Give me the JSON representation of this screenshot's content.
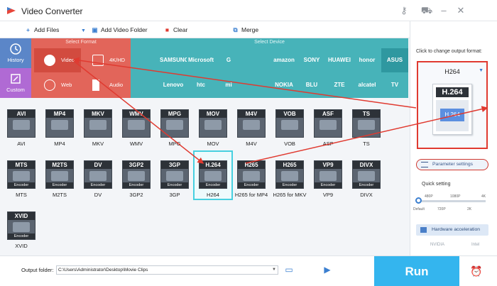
{
  "window": {
    "title": "Video Converter"
  },
  "toolbar": {
    "add_files": "Add Files",
    "add_video_folder": "Add Video Folder",
    "clear": "Clear",
    "merge": "Merge"
  },
  "nav": {
    "history": "History",
    "custom": "Custom"
  },
  "categories": {
    "header": "Select Format",
    "items": [
      {
        "label": "Video",
        "active": true
      },
      {
        "label": "4K/HD",
        "active": false
      },
      {
        "label": "Web",
        "active": false
      },
      {
        "label": "Audio",
        "active": false
      }
    ]
  },
  "devices": {
    "header": "Select Device",
    "brands": [
      "",
      "SAMSUNG",
      "Microsoft",
      "G",
      "",
      "amazon",
      "SONY",
      "HUAWEI",
      "honor",
      "ASUS",
      "",
      "Lenovo",
      "htc",
      "mi",
      "",
      "NOKIA",
      "BLU",
      "ZTE",
      "alcatel",
      "TV"
    ]
  },
  "formats": [
    {
      "tag": "AVI",
      "name": "AVI",
      "encoder": false
    },
    {
      "tag": "MP4",
      "name": "MP4",
      "encoder": false
    },
    {
      "tag": "MKV",
      "name": "MKV",
      "encoder": false
    },
    {
      "tag": "WMV",
      "name": "WMV",
      "encoder": false
    },
    {
      "tag": "MPG",
      "name": "MPG",
      "encoder": false
    },
    {
      "tag": "MOV",
      "name": "MOV",
      "encoder": false
    },
    {
      "tag": "M4V",
      "name": "M4V",
      "encoder": false
    },
    {
      "tag": "VOB",
      "name": "VOB",
      "encoder": false
    },
    {
      "tag": "ASF",
      "name": "ASF",
      "encoder": false
    },
    {
      "tag": "TS",
      "name": "TS",
      "encoder": false
    },
    {
      "tag": "MTS",
      "name": "MTS",
      "encoder": true
    },
    {
      "tag": "M2TS",
      "name": "M2TS",
      "encoder": true
    },
    {
      "tag": "DV",
      "name": "DV",
      "encoder": true
    },
    {
      "tag": "3GP2",
      "name": "3GP2",
      "encoder": true
    },
    {
      "tag": "3GP",
      "name": "3GP",
      "encoder": true
    },
    {
      "tag": "H.264",
      "name": "H264",
      "encoder": true,
      "selected": true
    },
    {
      "tag": "H265",
      "name": "H265 for MP4",
      "encoder": true
    },
    {
      "tag": "H265",
      "name": "H265 for MKV",
      "encoder": true
    },
    {
      "tag": "VP9",
      "name": "VP9",
      "encoder": true
    },
    {
      "tag": "DIVX",
      "name": "DIVX",
      "encoder": true
    },
    {
      "tag": "XVID",
      "name": "XVID",
      "encoder": true
    }
  ],
  "output": {
    "hint": "Click to change output format:",
    "current": "H264",
    "icon_tag": "H.264",
    "icon_inner": "H.264",
    "parameter_settings": "Parameter settings",
    "quick_setting": "Quick setting",
    "ticks_top": [
      "480P",
      "1080P",
      "4K"
    ],
    "ticks_bottom": [
      "Default",
      "720P",
      "2K"
    ],
    "quick_setting_level": 0,
    "hardware_acceleration": "Hardware acceleration",
    "vendors": [
      "NVIDIA",
      "Intel"
    ]
  },
  "bottom": {
    "output_folder_label": "Output folder:",
    "output_folder_value": "C:\\Users\\Administrator\\Desktop\\Movie Clips",
    "run": "Run"
  },
  "colors": {
    "accent": "#34b5ee",
    "highlight": "#e03a30",
    "category": "#e2655a",
    "device": "#47b3b9"
  }
}
